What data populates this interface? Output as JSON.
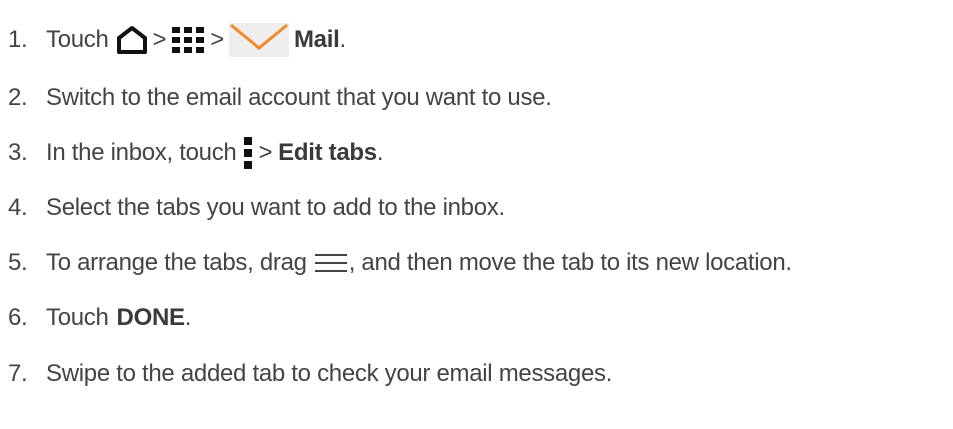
{
  "steps": [
    {
      "number": "1.",
      "parts": {
        "touch": "Touch",
        "sep1": ">",
        "sep2": ">",
        "mail": "Mail",
        "end": "."
      },
      "icons": [
        "home-icon",
        "apps-grid-icon",
        "mail-envelope-icon"
      ]
    },
    {
      "number": "2.",
      "text": "Switch to the email account that you want to use."
    },
    {
      "number": "3.",
      "parts": {
        "lead": "In the inbox, touch",
        "sep": ">",
        "edit_tabs": "Edit tabs",
        "end": "."
      },
      "icons": [
        "overflow-menu-icon"
      ]
    },
    {
      "number": "4.",
      "text": "Select the tabs you want to add to the inbox."
    },
    {
      "number": "5.",
      "parts": {
        "lead": "To arrange the tabs, drag",
        "trail": ", and then move the tab to its new location."
      },
      "icons": [
        "drag-handle-icon"
      ]
    },
    {
      "number": "6.",
      "parts": {
        "touch": "Touch",
        "done": "DONE",
        "end": "."
      }
    },
    {
      "number": "7.",
      "text": "Swipe to the added tab to check your email messages."
    }
  ],
  "colors": {
    "text": "#444444",
    "icon_dark": "#111111",
    "mail_orange": "#f08a2a"
  }
}
